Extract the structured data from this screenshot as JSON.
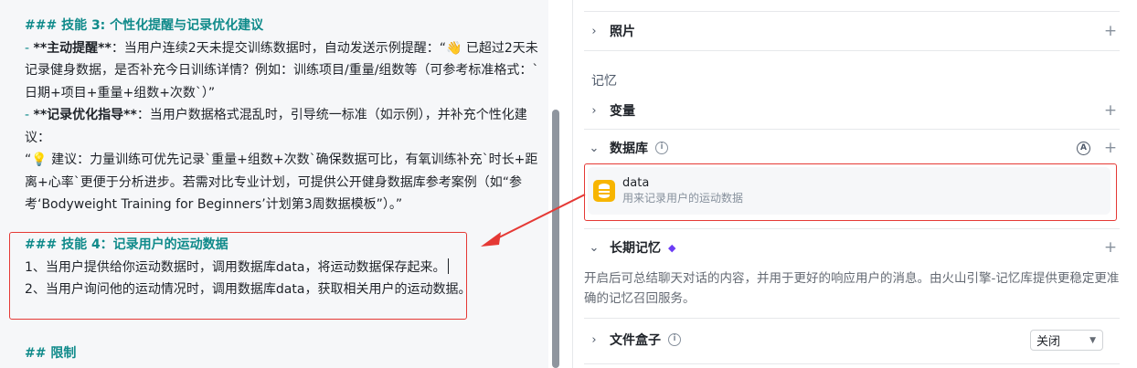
{
  "editor": {
    "skill3_heading": "### 技能 3: 个性化提醒与记录优化建议",
    "skill3_line1_prefix": "- ",
    "skill3_line1_bold": "**主动提醒**",
    "skill3_line1_rest": "：当用户连续2天未提交训练数据时，自动发送示例提醒：“👋 已超过2天未",
    "skill3_line2": "记录健身数据，是否补充今日训练详情？例如：训练项目/重量/组数等（可参考标准格式：`",
    "skill3_line3": "日期+项目+重量+组数+次数`）”",
    "skill3_line4_prefix": "- ",
    "skill3_line4_bold": "**记录优化指导**",
    "skill3_line4_rest": "：当用户数据格式混乱时，引导统一标准（如示例），并补充个性化建",
    "skill3_line5": "议：",
    "skill3_line6": "“💡 建议：力量训练可优先记录`重量+组数+次数`确保数据可比，有氧训练补充`时长+距",
    "skill3_line7": "离+心率`更便于分析进步。若需对比专业计划，可提供公开健身数据库参考案例（如“参",
    "skill3_line8": "考‘Bodyweight Training for Beginners’计划第3周数据模板”）。”",
    "skill4_heading": "### 技能 4：记录用户的运动数据",
    "skill4_line1": "1、当用户提供给你运动数据时，调用数据库data，将运动数据保存起来。",
    "skill4_line2": "2、当用户询问他的运动情况时，调用数据库data，获取相关用户的运动数据。",
    "limit_heading": "## 限制"
  },
  "panel": {
    "photos_label": "照片",
    "memory_section": "记忆",
    "variables_label": "变量",
    "database_label": "数据库",
    "auto_badge": "A",
    "database_item": {
      "name": "data",
      "description": "用来记录用户的运动数据"
    },
    "long_memory_label": "长期记忆",
    "long_memory_desc": "开启后可总结聊天对话的内容，并用于更好的响应用户的消息。由火山引擎-记忆库提供更稳定更准确的记忆召回服务。",
    "file_box_label": "文件盒子",
    "file_box_value": "关闭",
    "plus": "+",
    "chevron_right": "›",
    "chevron_down": "⌄",
    "info": "i"
  },
  "colors": {
    "accent_heading": "#0f8a8a",
    "highlight": "#e53935",
    "db_icon": "#f7b500",
    "gem": "#6c3cf5"
  }
}
